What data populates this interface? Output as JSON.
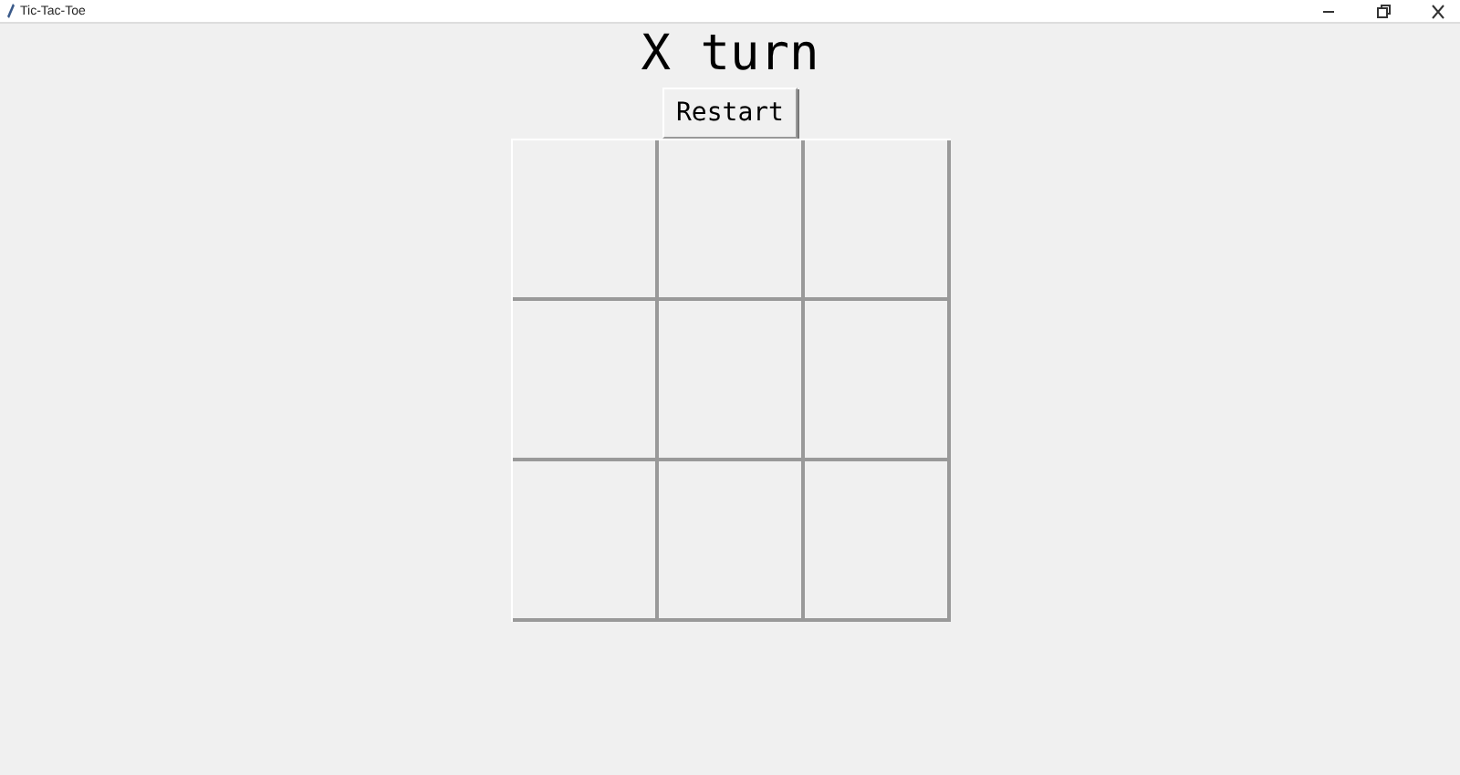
{
  "window": {
    "title": "Tic-Tac-Toe"
  },
  "status": "X turn",
  "restart_button": "Restart"
}
